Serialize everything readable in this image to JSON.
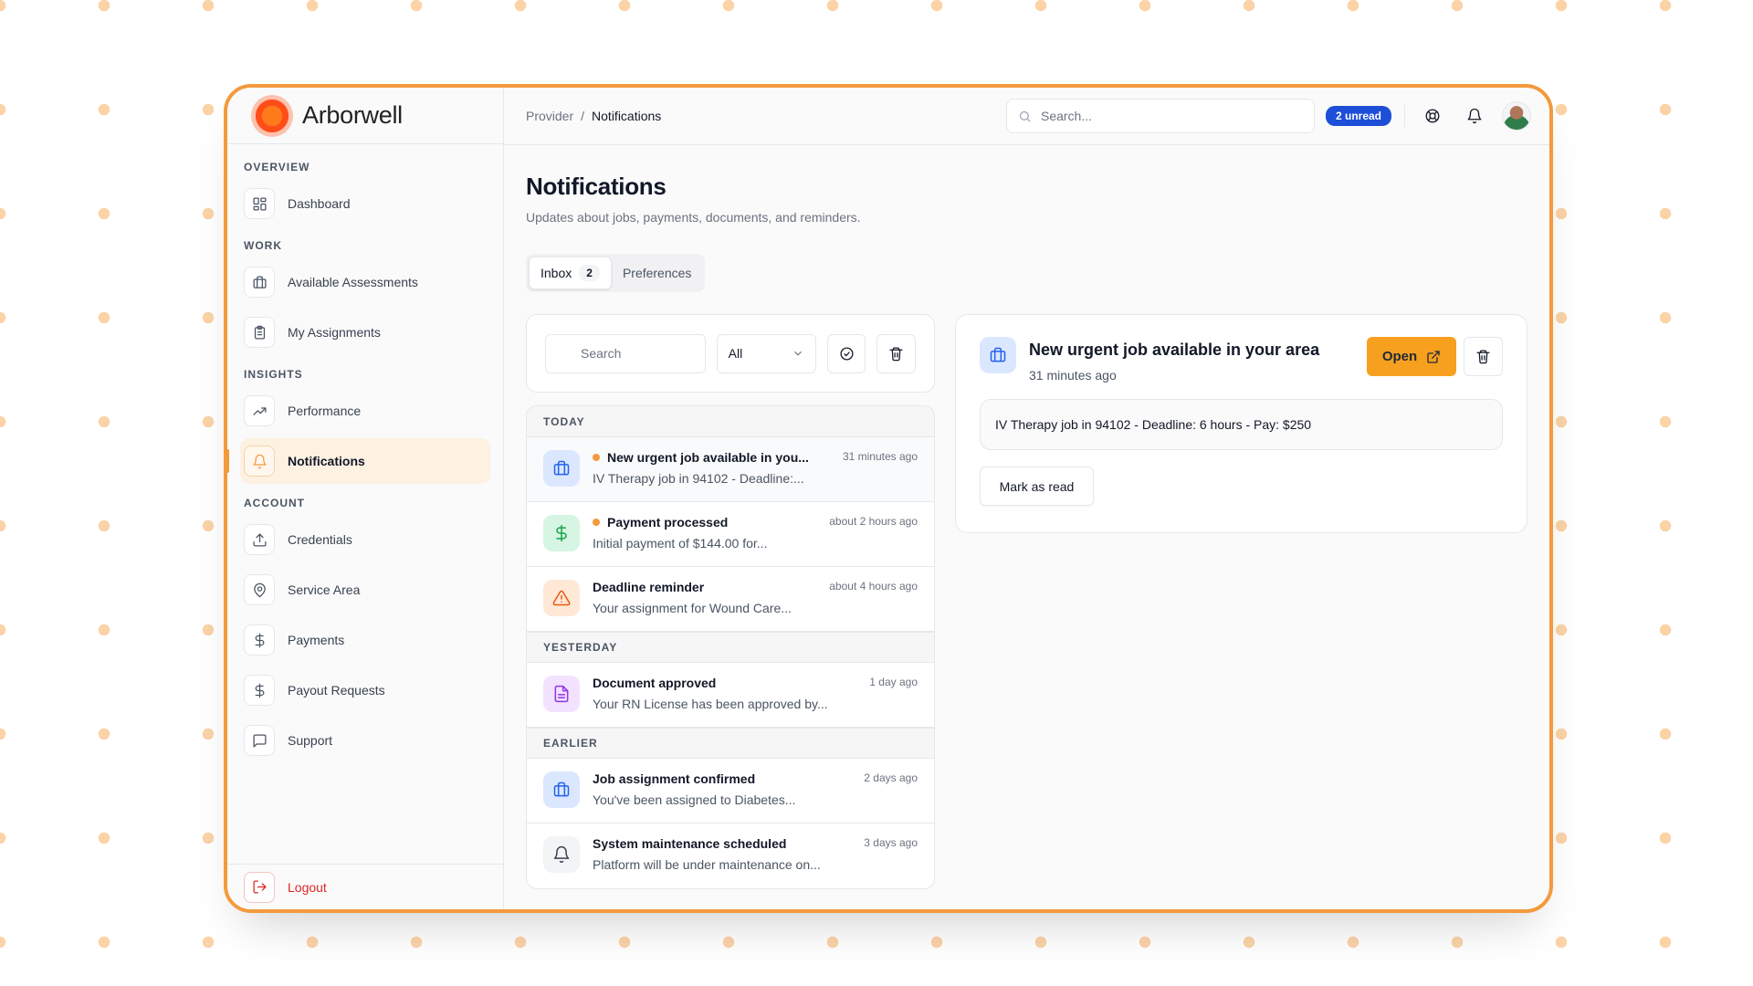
{
  "app": {
    "brand_name": "Arborwell"
  },
  "sidebar": {
    "sections": {
      "overview": "OVERVIEW",
      "work": "WORK",
      "insights": "INSIGHTS",
      "account": "ACCOUNT"
    },
    "items": {
      "dashboard": "Dashboard",
      "available_assessments": "Available Assessments",
      "my_assignments": "My Assignments",
      "performance": "Performance",
      "notifications": "Notifications",
      "credentials": "Credentials",
      "service_area": "Service Area",
      "payments": "Payments",
      "payout_requests": "Payout Requests",
      "support": "Support"
    },
    "active_item": "notifications",
    "logout": "Logout"
  },
  "topbar": {
    "breadcrumb": [
      "Provider",
      "/",
      "Notifications"
    ],
    "search_placeholder": "Search...",
    "unread_badge": "2 unread"
  },
  "page": {
    "title": "Notifications",
    "subtitle": "Updates about jobs, payments, documents, and reminders."
  },
  "tabs": {
    "inbox_label": "Inbox",
    "inbox_count": "2",
    "preferences_label": "Preferences"
  },
  "filters": {
    "search_placeholder": "Search",
    "type_selected": "All"
  },
  "groups": {
    "today": "TODAY",
    "yesterday": "YESTERDAY",
    "earlier": "EARLIER"
  },
  "notifications": [
    {
      "title": "New urgent job available in you...",
      "desc": "IV Therapy job in 94102 - Deadline:...",
      "time": "31 minutes ago",
      "icon": "briefcase-icon",
      "unread": true
    },
    {
      "title": "Payment processed",
      "desc": "Initial payment of $144.00 for...",
      "time": "about 2 hours ago",
      "icon": "dollar-icon",
      "unread": true
    },
    {
      "title": "Deadline reminder",
      "desc": "Your assignment for Wound Care...",
      "time": "about 4 hours ago",
      "icon": "warning-icon",
      "unread": false
    },
    {
      "title": "Document approved",
      "desc": "Your RN License has been approved by...",
      "time": "1 day ago",
      "icon": "document-icon",
      "unread": false
    },
    {
      "title": "Job assignment confirmed",
      "desc": "You've been assigned to Diabetes...",
      "time": "2 days ago",
      "icon": "briefcase-icon",
      "unread": false
    },
    {
      "title": "System maintenance scheduled",
      "desc": "Platform will be under maintenance on...",
      "time": "3 days ago",
      "icon": "bell-icon",
      "unread": false
    }
  ],
  "detail": {
    "title": "New urgent job available in your area",
    "time": "31 minutes ago",
    "open_label": "Open",
    "message": "IV Therapy job in 94102 - Deadline: 6 hours - Pay: $250",
    "mark_read_label": "Mark as read"
  },
  "colors": {
    "accent": "#f39a3c",
    "badge_blue": "#1d4ed8",
    "logout_red": "#dc2626",
    "open_button": "#f7a01f"
  }
}
